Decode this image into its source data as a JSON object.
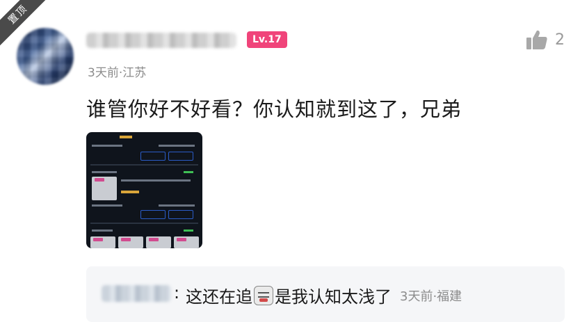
{
  "pinned_label": "置顶",
  "comment": {
    "level_badge": "Lv.17",
    "time_location": "3天前·江苏",
    "like_count": "2",
    "text": "谁管你好不好看？你认知就到这了，兄弟"
  },
  "reply": {
    "colon": ":",
    "text_before_emoji": "这还在追",
    "emoji_icon": "sticker-emoji-icon",
    "text_after_emoji": "是我认知太浅了",
    "time_location": "3天前·福建"
  },
  "colors": {
    "level_badge": "#f0447a",
    "meta_gray": "#8c8c8c",
    "reply_bg": "#f5f6f8"
  }
}
